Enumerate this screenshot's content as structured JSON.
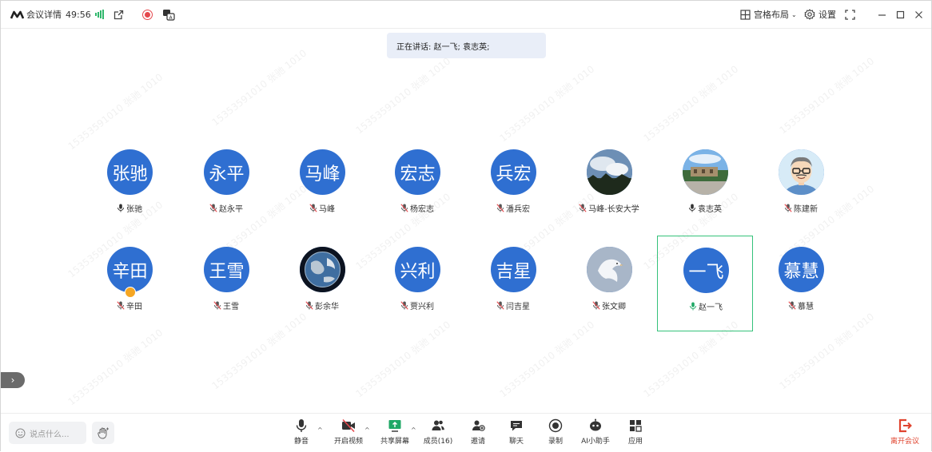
{
  "topbar": {
    "title": "会议详情",
    "timer": "49:56",
    "layout_label": "宫格布局",
    "settings_label": "设置",
    "brand_color": "#2f6fd1"
  },
  "speaking": {
    "text": "正在讲话: 赵一飞; 袁志英;"
  },
  "watermark": {
    "text": "15353591010 张驰 1010"
  },
  "participants": [
    {
      "avatar_text": "张驰",
      "name": "张驰",
      "mic": "on",
      "photo": false
    },
    {
      "avatar_text": "永平",
      "name": "赵永平",
      "mic": "muted",
      "photo": false
    },
    {
      "avatar_text": "马峰",
      "name": "马峰",
      "mic": "muted",
      "photo": false
    },
    {
      "avatar_text": "宏志",
      "name": "杨宏志",
      "mic": "muted",
      "photo": false
    },
    {
      "avatar_text": "兵宏",
      "name": "潘兵宏",
      "mic": "muted",
      "photo": false
    },
    {
      "avatar_text": "",
      "name": "马峰-长安大学",
      "mic": "muted",
      "photo": "sky"
    },
    {
      "avatar_text": "",
      "name": "袁志英",
      "mic": "on",
      "photo": "campus"
    },
    {
      "avatar_text": "",
      "name": "陈建新",
      "mic": "muted",
      "photo": "cartoon"
    },
    {
      "avatar_text": "辛田",
      "name": "辛田",
      "mic": "muted",
      "photo": false,
      "host": true
    },
    {
      "avatar_text": "王雪",
      "name": "王雪",
      "mic": "muted",
      "photo": false
    },
    {
      "avatar_text": "",
      "name": "彭余华",
      "mic": "muted",
      "photo": "earth"
    },
    {
      "avatar_text": "兴利",
      "name": "贾兴利",
      "mic": "muted",
      "photo": false
    },
    {
      "avatar_text": "吉星",
      "name": "闫吉星",
      "mic": "muted",
      "photo": false
    },
    {
      "avatar_text": "",
      "name": "张文卿",
      "mic": "muted",
      "photo": "bird"
    },
    {
      "avatar_text": "一飞",
      "name": "赵一飞",
      "mic": "speaking",
      "photo": false,
      "selected": true
    },
    {
      "avatar_text": "慕慧",
      "name": "慕慧",
      "mic": "muted",
      "photo": false
    }
  ],
  "bottombar": {
    "chat_placeholder": "说点什么...",
    "mute_label": "静音",
    "video_label": "开启视频",
    "share_label": "共享屏幕",
    "members_label": "成员(16)",
    "invite_label": "邀请",
    "chat_label": "聊天",
    "record_label": "录制",
    "ai_label": "AI小助手",
    "apps_label": "应用",
    "leave_label": "离开会议"
  }
}
